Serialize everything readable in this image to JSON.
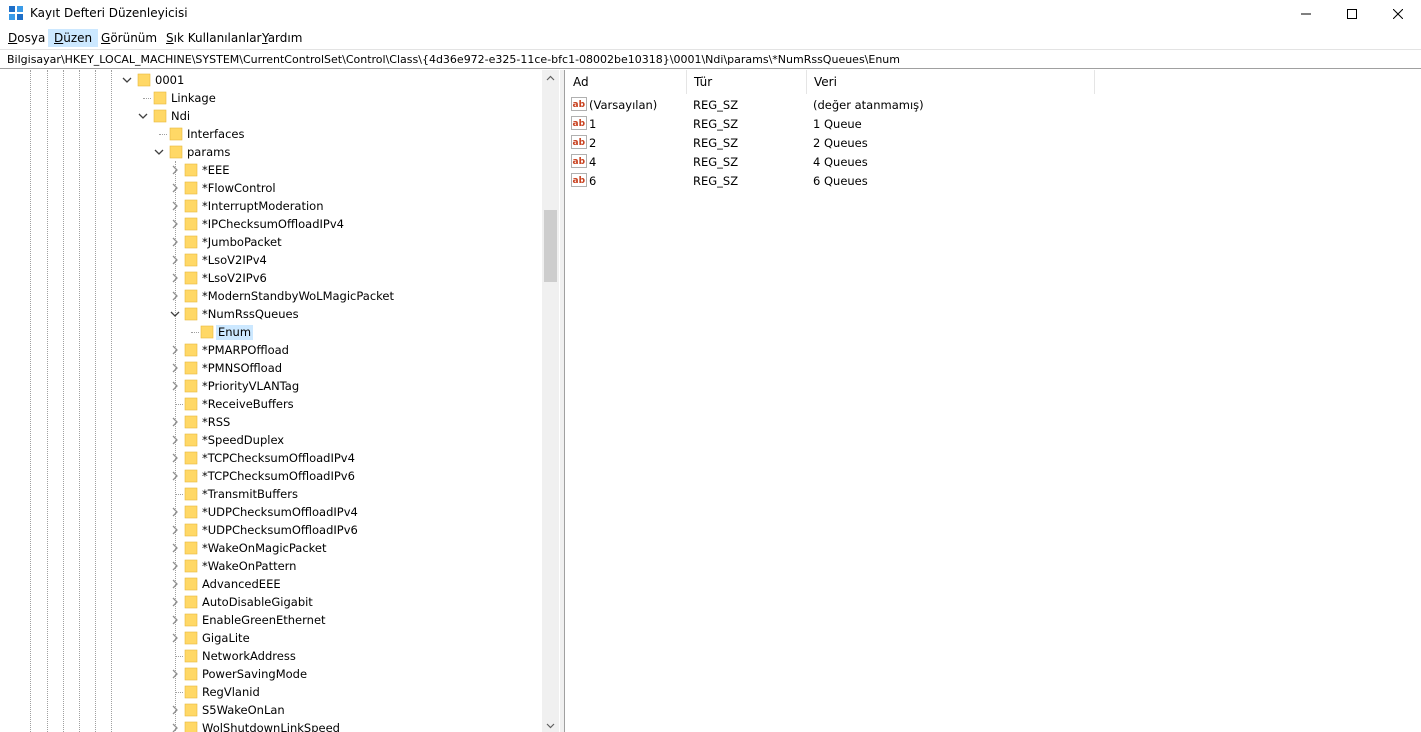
{
  "window": {
    "title": "Kayıt Defteri Düzenleyicisi",
    "icon": "registry-editor-icon"
  },
  "menu": [
    {
      "label": "Dosya",
      "accel": "D",
      "rest": "osya",
      "active": false
    },
    {
      "label": "Düzen",
      "accel": "D",
      "rest": "üzen",
      "active": true
    },
    {
      "label": "Görünüm",
      "accel": "G",
      "rest": "örünüm",
      "active": false
    },
    {
      "label": "Sık Kullanılanlar",
      "accel": "S",
      "rest": "ık Kullanılanlar",
      "active": false
    },
    {
      "label": "Yardım",
      "accel": "Y",
      "rest": "ardım",
      "active": false
    }
  ],
  "address": "Bilgisayar\\HKEY_LOCAL_MACHINE\\SYSTEM\\CurrentControlSet\\Control\\Class\\{4d36e972-e325-11ce-bfc1-08002be10318}\\0001\\Ndi\\params\\*NumRssQueues\\Enum",
  "tree": [
    {
      "label": "0001",
      "level": 0,
      "expander": "expanded"
    },
    {
      "label": "Linkage",
      "level": 1,
      "expander": "none"
    },
    {
      "label": "Ndi",
      "level": 1,
      "expander": "expanded"
    },
    {
      "label": "Interfaces",
      "level": 2,
      "expander": "none"
    },
    {
      "label": "params",
      "level": 2,
      "expander": "expanded"
    },
    {
      "label": "*EEE",
      "level": 3,
      "expander": "collapsed"
    },
    {
      "label": "*FlowControl",
      "level": 3,
      "expander": "collapsed"
    },
    {
      "label": "*InterruptModeration",
      "level": 3,
      "expander": "collapsed"
    },
    {
      "label": "*IPChecksumOffloadIPv4",
      "level": 3,
      "expander": "collapsed"
    },
    {
      "label": "*JumboPacket",
      "level": 3,
      "expander": "collapsed"
    },
    {
      "label": "*LsoV2IPv4",
      "level": 3,
      "expander": "collapsed"
    },
    {
      "label": "*LsoV2IPv6",
      "level": 3,
      "expander": "collapsed"
    },
    {
      "label": "*ModernStandbyWoLMagicPacket",
      "level": 3,
      "expander": "collapsed"
    },
    {
      "label": "*NumRssQueues",
      "level": 3,
      "expander": "expanded"
    },
    {
      "label": "Enum",
      "level": 4,
      "expander": "none",
      "selected": true
    },
    {
      "label": "*PMARPOffload",
      "level": 3,
      "expander": "collapsed"
    },
    {
      "label": "*PMNSOffload",
      "level": 3,
      "expander": "collapsed"
    },
    {
      "label": "*PriorityVLANTag",
      "level": 3,
      "expander": "collapsed"
    },
    {
      "label": "*ReceiveBuffers",
      "level": 3,
      "expander": "none"
    },
    {
      "label": "*RSS",
      "level": 3,
      "expander": "collapsed"
    },
    {
      "label": "*SpeedDuplex",
      "level": 3,
      "expander": "collapsed"
    },
    {
      "label": "*TCPChecksumOffloadIPv4",
      "level": 3,
      "expander": "collapsed"
    },
    {
      "label": "*TCPChecksumOffloadIPv6",
      "level": 3,
      "expander": "collapsed"
    },
    {
      "label": "*TransmitBuffers",
      "level": 3,
      "expander": "none"
    },
    {
      "label": "*UDPChecksumOffloadIPv4",
      "level": 3,
      "expander": "collapsed"
    },
    {
      "label": "*UDPChecksumOffloadIPv6",
      "level": 3,
      "expander": "collapsed"
    },
    {
      "label": "*WakeOnMagicPacket",
      "level": 3,
      "expander": "collapsed"
    },
    {
      "label": "*WakeOnPattern",
      "level": 3,
      "expander": "collapsed"
    },
    {
      "label": "AdvancedEEE",
      "level": 3,
      "expander": "collapsed"
    },
    {
      "label": "AutoDisableGigabit",
      "level": 3,
      "expander": "collapsed"
    },
    {
      "label": "EnableGreenEthernet",
      "level": 3,
      "expander": "collapsed"
    },
    {
      "label": "GigaLite",
      "level": 3,
      "expander": "collapsed"
    },
    {
      "label": "NetworkAddress",
      "level": 3,
      "expander": "none"
    },
    {
      "label": "PowerSavingMode",
      "level": 3,
      "expander": "collapsed"
    },
    {
      "label": "RegVlanid",
      "level": 3,
      "expander": "none"
    },
    {
      "label": "S5WakeOnLan",
      "level": 3,
      "expander": "collapsed"
    },
    {
      "label": "WolShutdownLinkSpeed",
      "level": 3,
      "expander": "collapsed"
    }
  ],
  "list": {
    "columns": [
      "Ad",
      "Tür",
      "Veri"
    ],
    "rows": [
      {
        "name": "(Varsayılan)",
        "type": "REG_SZ",
        "data": "(değer atanmamış)"
      },
      {
        "name": "1",
        "type": "REG_SZ",
        "data": "1 Queue"
      },
      {
        "name": "2",
        "type": "REG_SZ",
        "data": "2 Queues"
      },
      {
        "name": "4",
        "type": "REG_SZ",
        "data": "4 Queues"
      },
      {
        "name": "6",
        "type": "REG_SZ",
        "data": "6 Queues"
      }
    ]
  },
  "colors": {
    "selection": "#cce8ff",
    "folder": "#ffd866",
    "folder_edge": "#e6b93c",
    "string_icon": "#c8401e"
  }
}
